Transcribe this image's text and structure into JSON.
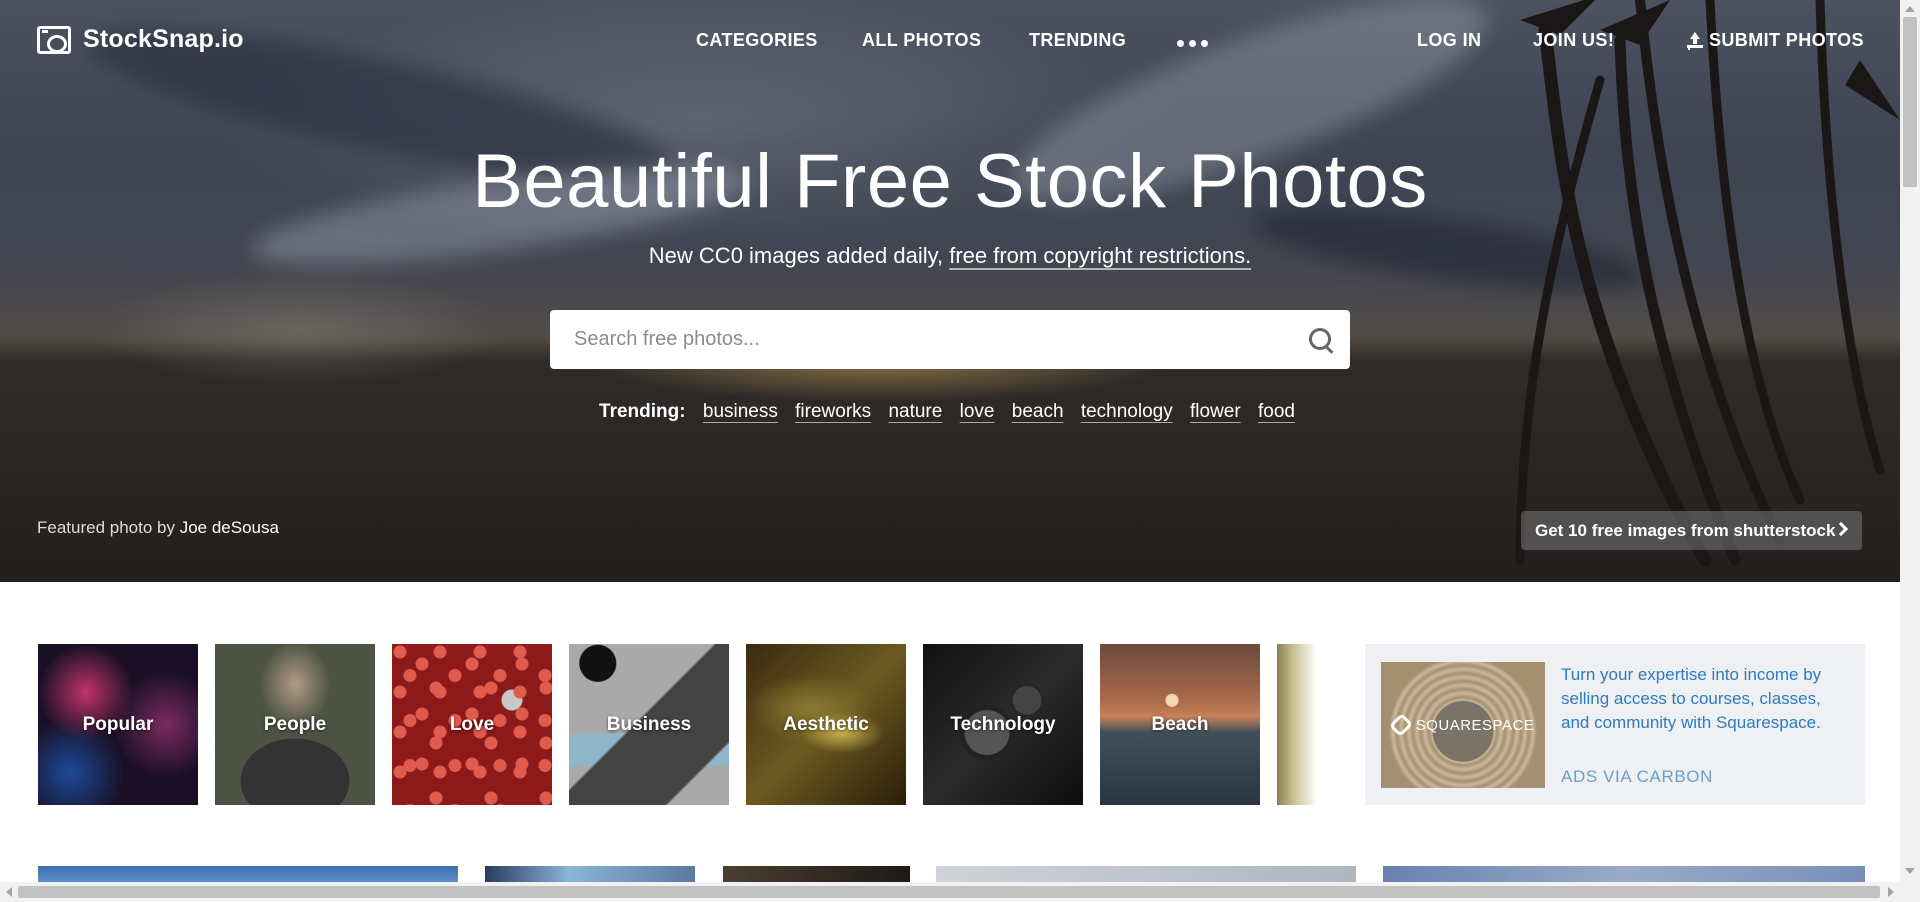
{
  "brand": {
    "name": "StockSnap.io",
    "icon": "camera-icon"
  },
  "nav": {
    "categories": "CATEGORIES",
    "all_photos": "ALL PHOTOS",
    "trending": "TRENDING",
    "more_icon": "more-dots-icon",
    "login": "LOG IN",
    "join": "JOIN US!",
    "submit": "SUBMIT PHOTOS",
    "submit_icon": "upload-icon"
  },
  "hero": {
    "headline": "Beautiful Free Stock Photos",
    "sub_prefix": "New CC0 images added daily, ",
    "sub_link": "free from copyright restrictions.",
    "search_placeholder": "Search free photos...",
    "search_value": "",
    "trending_label": "Trending:",
    "trending_tags": [
      "business",
      "fireworks",
      "nature",
      "love",
      "beach",
      "technology",
      "flower",
      "food"
    ],
    "featured_prefix": "Featured photo by ",
    "featured_author": "Joe deSousa",
    "shutterstock_cta": "Get 10 free images from shutterstock"
  },
  "categories": [
    "Popular",
    "People",
    "Love",
    "Business",
    "Aesthetic",
    "Technology",
    "Beach"
  ],
  "ad": {
    "image_text": "SQUARESPACE",
    "text": "Turn your expertise into income by selling access to courses, classes, and community with Squarespace.",
    "via": "ADS VIA CARBON"
  },
  "colors": {
    "ad_link": "#2f7bbf",
    "ad_background": "#eef0f3",
    "hero_overlay": "#3e4452"
  }
}
